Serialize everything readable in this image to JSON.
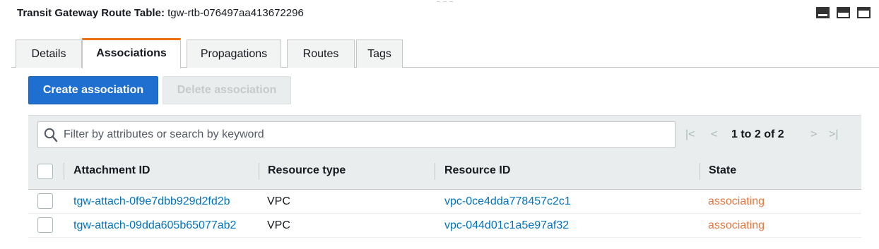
{
  "header": {
    "title_label": "Transit Gateway Route Table:",
    "title_value": "tgw-rtb-076497aa413672296"
  },
  "tabs": [
    {
      "label": "Details"
    },
    {
      "label": "Associations",
      "active": true
    },
    {
      "label": "Propagations"
    },
    {
      "label": "Routes"
    },
    {
      "label": "Tags"
    }
  ],
  "actions": {
    "create_label": "Create association",
    "delete_label": "Delete association"
  },
  "filter": {
    "placeholder": "Filter by attributes or search by keyword",
    "value": ""
  },
  "pagination": {
    "first": "|<",
    "prev": "<",
    "text": "1 to 2 of 2",
    "next": ">",
    "last": ">|"
  },
  "table": {
    "columns": [
      "Attachment ID",
      "Resource type",
      "Resource ID",
      "State"
    ],
    "rows": [
      {
        "attachment_id": "tgw-attach-0f9e7dbb929d2fd2b",
        "resource_type": "VPC",
        "resource_id": "vpc-0ce4dda778457c2c1",
        "state": "associating"
      },
      {
        "attachment_id": "tgw-attach-09dda605b65077ab2",
        "resource_type": "VPC",
        "resource_id": "vpc-044d01c1a5e97af32",
        "state": "associating"
      }
    ]
  },
  "colors": {
    "accent_tab": "#ec7211",
    "primary_button": "#1f6fd1",
    "link": "#0073bb",
    "state_pending": "#e07941"
  },
  "icons": {
    "search": "search-icon",
    "layout": [
      "layout-full-icon",
      "layout-split-icon",
      "layout-top-icon"
    ]
  }
}
